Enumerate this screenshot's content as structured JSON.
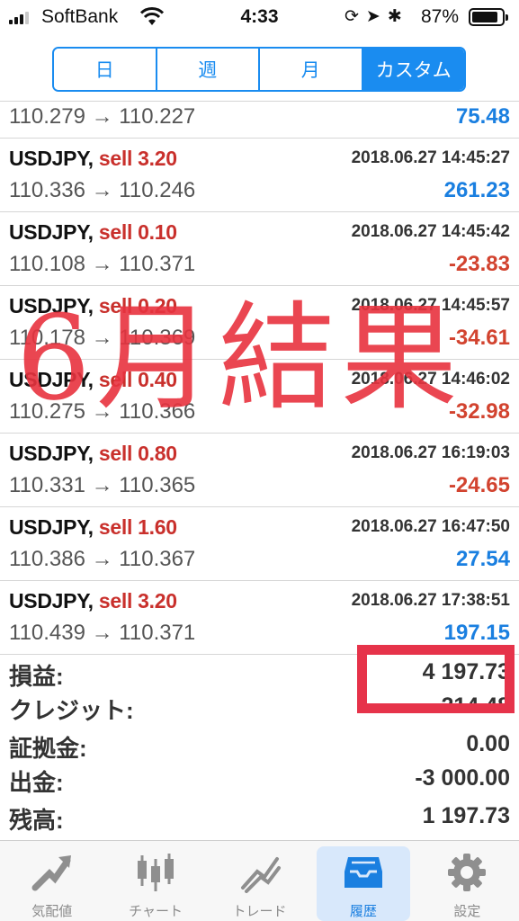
{
  "status_bar": {
    "carrier": "SoftBank",
    "time": "4:33",
    "battery": "87%"
  },
  "period_tabs": [
    {
      "label": "日",
      "active": false
    },
    {
      "label": "週",
      "active": false
    },
    {
      "label": "月",
      "active": false
    },
    {
      "label": "カスタム",
      "active": true
    }
  ],
  "trades": [
    {
      "symbol": "",
      "side": "",
      "time": "",
      "prices": "110.279 → 110.227",
      "profit": "75.48",
      "positive": true
    },
    {
      "symbol": "USDJPY,",
      "side": "sell 3.20",
      "time": "2018.06.27 14:45:27",
      "prices": "110.336 → 110.246",
      "profit": "261.23",
      "positive": true
    },
    {
      "symbol": "USDJPY,",
      "side": "sell 0.10",
      "time": "2018.06.27 14:45:42",
      "prices": "110.108 → 110.371",
      "profit": "-23.83",
      "positive": false
    },
    {
      "symbol": "USDJPY,",
      "side": "sell 0.20",
      "time": "2018.06.27 14:45:57",
      "prices": "110.178 → 110.369",
      "profit": "-34.61",
      "positive": false
    },
    {
      "symbol": "USDJPY,",
      "side": "sell 0.40",
      "time": "2018.06.27 14:46:02",
      "prices": "110.275 → 110.366",
      "profit": "-32.98",
      "positive": false
    },
    {
      "symbol": "USDJPY,",
      "side": "sell 0.80",
      "time": "2018.06.27 16:19:03",
      "prices": "110.331 → 110.365",
      "profit": "-24.65",
      "positive": false
    },
    {
      "symbol": "USDJPY,",
      "side": "sell 1.60",
      "time": "2018.06.27 16:47:50",
      "prices": "110.386 → 110.367",
      "profit": "27.54",
      "positive": true
    },
    {
      "symbol": "USDJPY,",
      "side": "sell 3.20",
      "time": "2018.06.27 17:38:51",
      "prices": "110.439 → 110.371",
      "profit": "197.15",
      "positive": true
    }
  ],
  "summary": {
    "profit_label": "損益:",
    "profit_value": "4 197.73",
    "credit_label": "クレジット:",
    "credit_value": "214.48",
    "deposit_label": "証拠金:",
    "deposit_value": "0.00",
    "withdrawal_label": "出金:",
    "withdrawal_value": "-3 000.00",
    "balance_label": "残高:",
    "balance_value": "1 197.73"
  },
  "overlay": {
    "text": "6月結果"
  },
  "tab_bar": [
    {
      "label": "気配値",
      "icon": "quotes-icon",
      "active": false
    },
    {
      "label": "チャート",
      "icon": "chart-icon",
      "active": false
    },
    {
      "label": "トレード",
      "icon": "trade-icon",
      "active": false
    },
    {
      "label": "履歴",
      "icon": "history-icon",
      "active": true
    },
    {
      "label": "設定",
      "icon": "gear-icon",
      "active": false
    }
  ],
  "colors": {
    "accent": "#1a8cf0",
    "positive": "#1a7fe0",
    "negative": "#d2432f",
    "sell": "#c9302c",
    "overlay": "#e8333f"
  }
}
